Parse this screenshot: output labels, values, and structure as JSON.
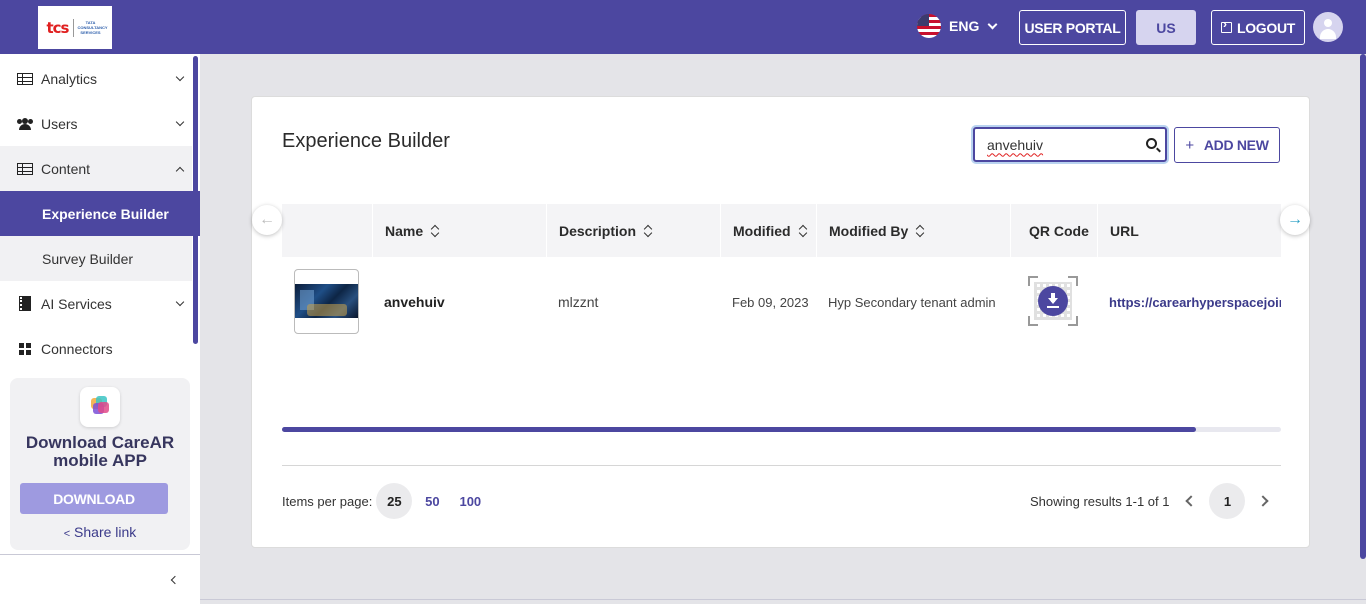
{
  "header": {
    "logo": {
      "brand": "tcs",
      "sub": "TATA CONSULTANCY SERVICES"
    },
    "language": "ENG",
    "user_portal_label": "USER PORTAL",
    "region_label": "US",
    "logout_label": "LOGOUT"
  },
  "sidebar": {
    "items": [
      {
        "label": "Analytics",
        "icon": "table-icon"
      },
      {
        "label": "Users",
        "icon": "users-icon"
      },
      {
        "label": "Content",
        "icon": "table-icon"
      },
      {
        "label": "Experience Builder"
      },
      {
        "label": "Survey Builder"
      },
      {
        "label": "AI Services",
        "icon": "chip-icon"
      },
      {
        "label": "Connectors",
        "icon": "grid-icon"
      }
    ],
    "promo": {
      "title": "Download CareAR mobile APP",
      "download_label": "DOWNLOAD",
      "share_label": "Share link"
    }
  },
  "main": {
    "title": "Experience Builder",
    "search": {
      "value": "anvehuiv"
    },
    "add_new_label": "ADD NEW",
    "table": {
      "columns": [
        "",
        "Name",
        "Description",
        "Modified",
        "Modified By",
        "QR Code",
        "URL"
      ],
      "rows": [
        {
          "name": "anvehuiv",
          "description": "mlzznt",
          "modified": "Feb 09, 2023",
          "modified_by": "Hyp Secondary tenant admin",
          "url": "https://carearhyperspacejoin."
        }
      ],
      "horizontal_scroll_fraction": 0.915
    },
    "pagination": {
      "items_per_page_label": "Items per page:",
      "options": [
        "25",
        "50",
        "100"
      ],
      "selected": "25",
      "results_text": "Showing results 1-1 of 1",
      "current_page": "1"
    }
  }
}
